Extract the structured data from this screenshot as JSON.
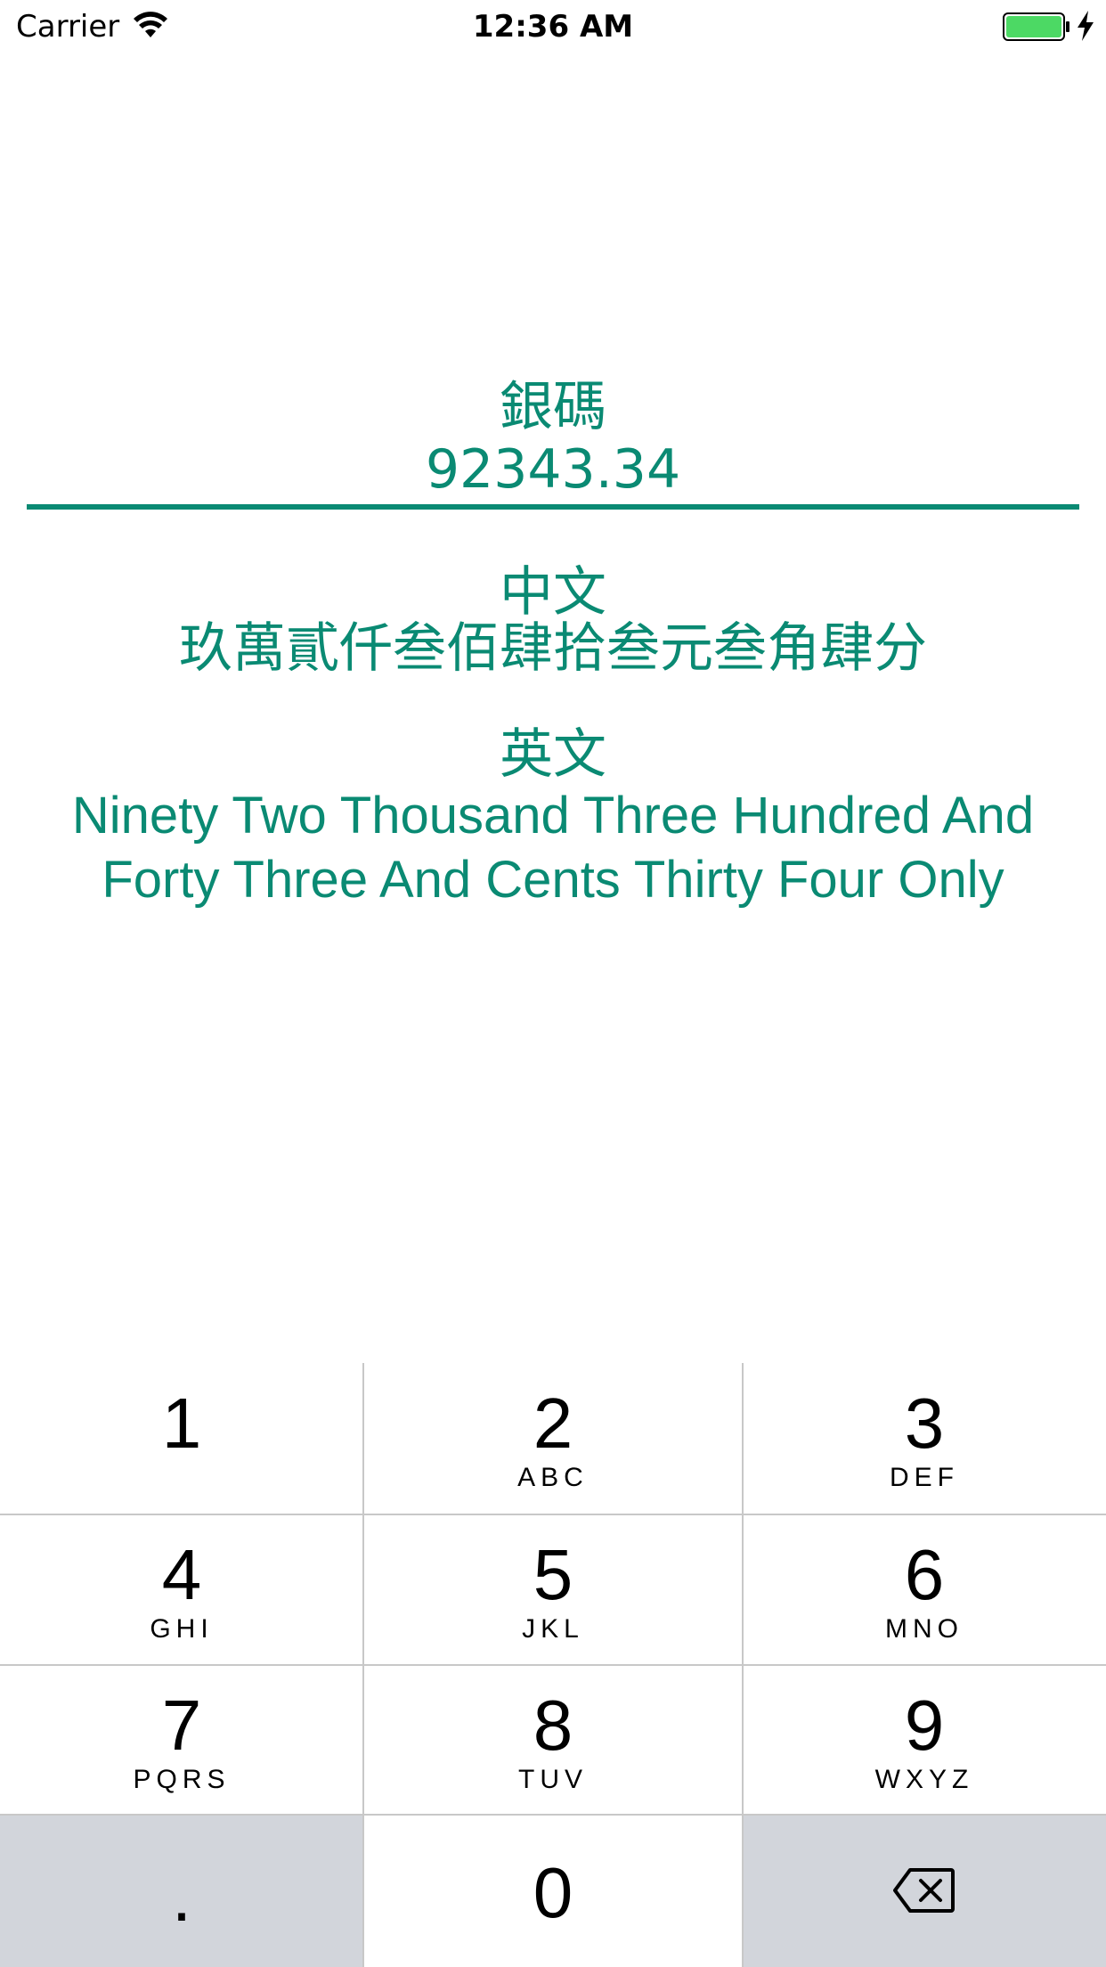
{
  "status_bar": {
    "carrier": "Carrier",
    "time": "12:36 AM",
    "wifi_icon": "wifi-icon",
    "battery_icon": "battery-icon",
    "charging_icon": "charging-bolt-icon",
    "battery_color": "#4cd964"
  },
  "converter": {
    "bank_label": "銀碼",
    "amount_value": "92343.34",
    "chinese_label": "中文",
    "chinese_value": "玖萬貳仟叁佰肆拾叁元叁角肆分",
    "english_label": "英文",
    "english_value": "Ninety Two Thousand Three Hundred And Forty Three And Cents Thirty Four Only",
    "accent_color": "#0a8a73"
  },
  "keypad": {
    "keys": [
      {
        "num": "1",
        "letters": ""
      },
      {
        "num": "2",
        "letters": "ABC"
      },
      {
        "num": "3",
        "letters": "DEF"
      },
      {
        "num": "4",
        "letters": "GHI"
      },
      {
        "num": "5",
        "letters": "JKL"
      },
      {
        "num": "6",
        "letters": "MNO"
      },
      {
        "num": "7",
        "letters": "PQRS"
      },
      {
        "num": "8",
        "letters": "TUV"
      },
      {
        "num": "9",
        "letters": "WXYZ"
      }
    ],
    "decimal": ".",
    "zero": "0",
    "backspace_icon": "backspace-icon",
    "gray_key_color": "#d2d5db"
  }
}
